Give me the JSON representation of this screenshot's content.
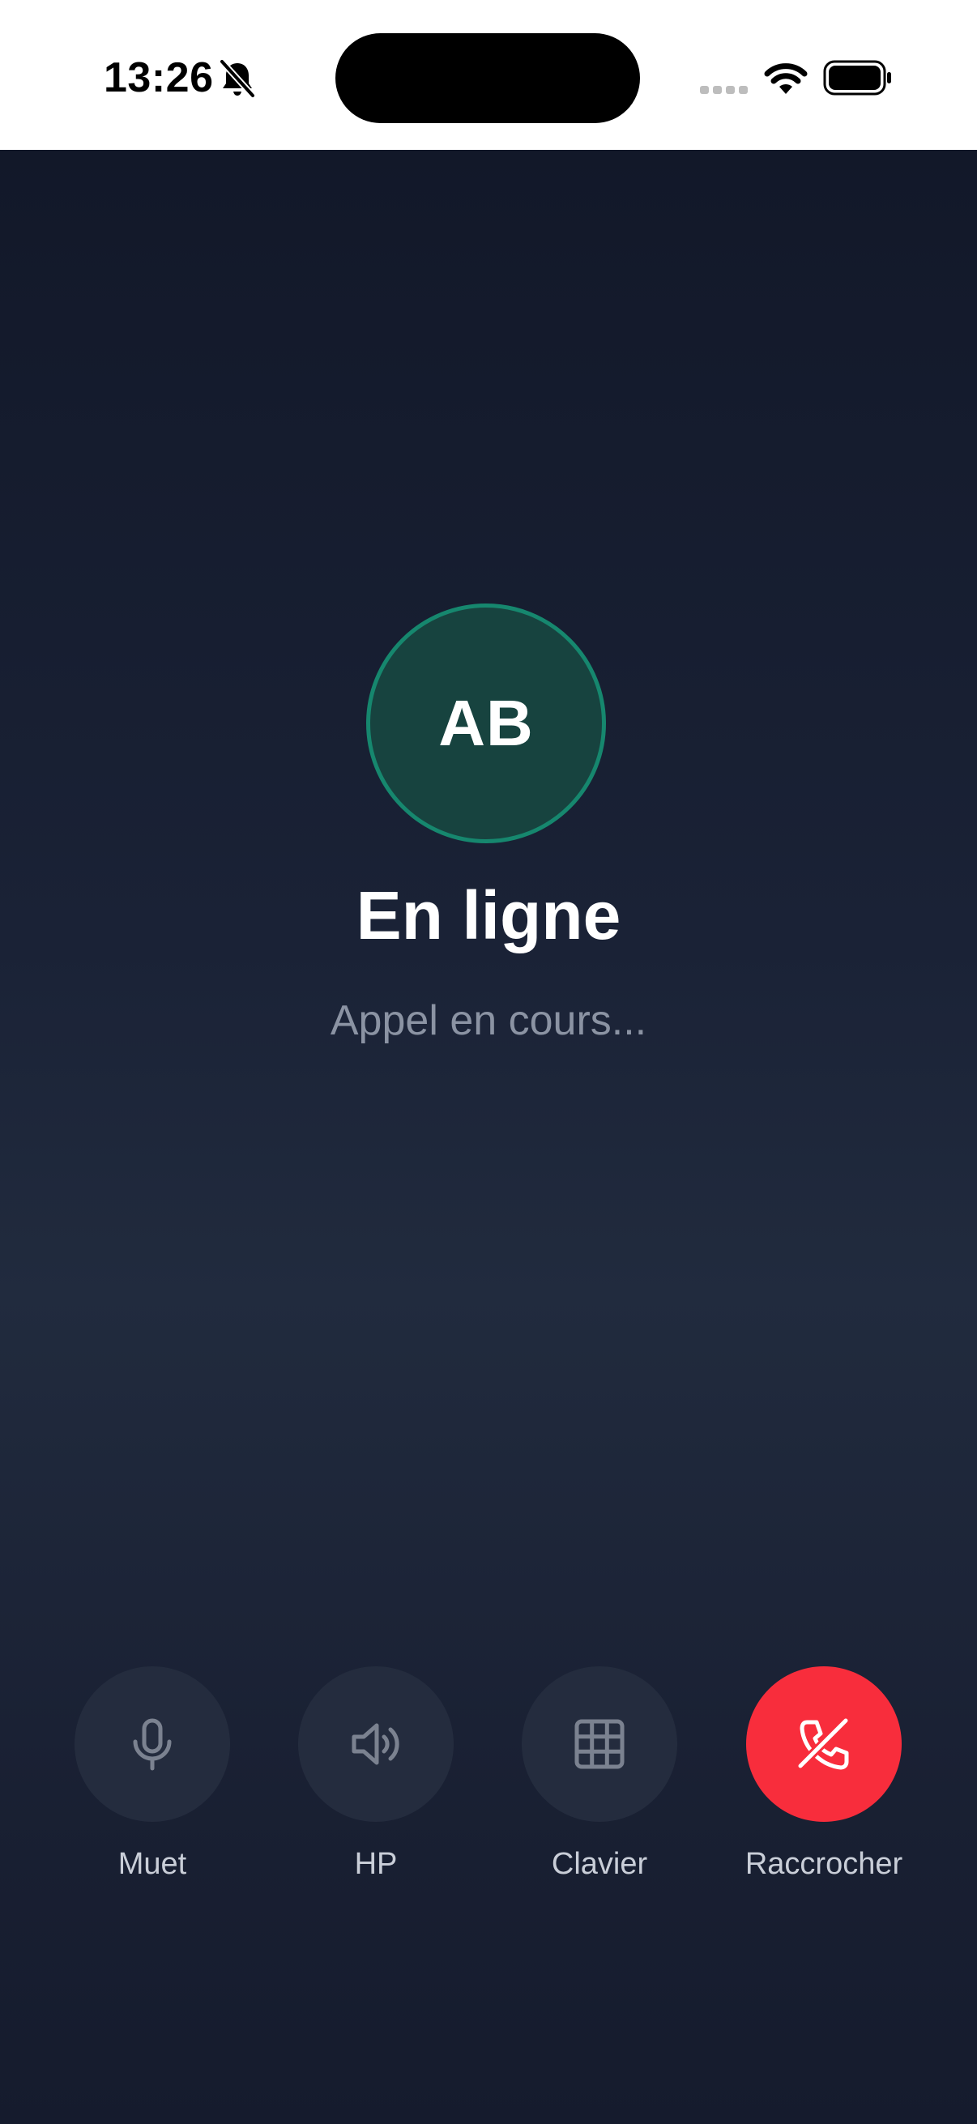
{
  "status_bar": {
    "time": "13:26",
    "icons": [
      "bell-slash-icon",
      "cellular-signal-icon",
      "wifi-icon",
      "battery-icon"
    ]
  },
  "call": {
    "avatar_initials": "AB",
    "name": "En ligne",
    "status": "Appel en cours..."
  },
  "controls": [
    {
      "label": "Muet",
      "icon": "microphone-icon"
    },
    {
      "label": "HP",
      "icon": "speaker-icon"
    },
    {
      "label": "Clavier",
      "icon": "keypad-icon"
    },
    {
      "label": "Raccrocher",
      "icon": "end-call-icon"
    }
  ],
  "colors": {
    "avatar_border": "#16876e",
    "avatar_fill": "#17433f",
    "end_call": "#f82d3c",
    "control_bg": "#242c3e",
    "background": "#1a2236"
  }
}
